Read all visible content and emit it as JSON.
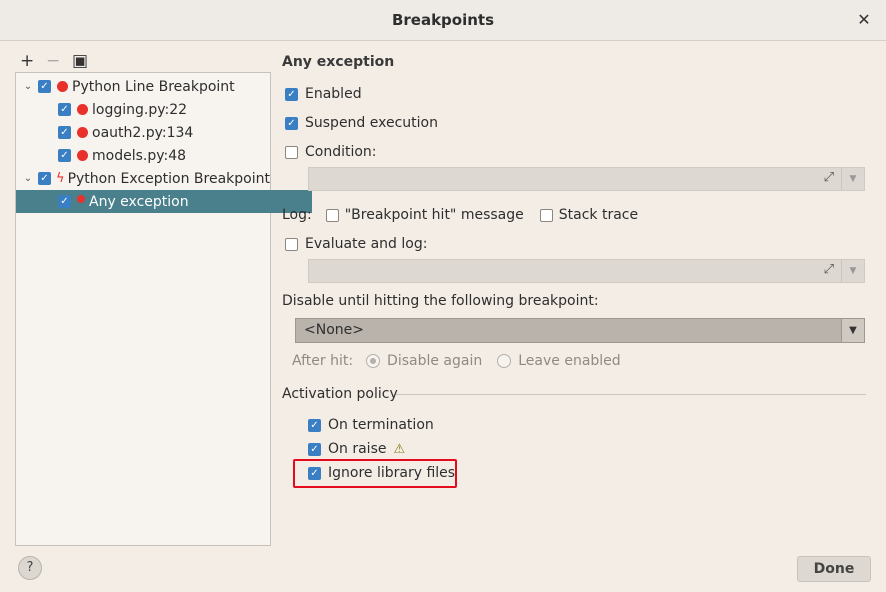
{
  "window": {
    "title": "Breakpoints",
    "close_glyph": "✕"
  },
  "toolbar": {
    "add": "+",
    "remove": "−",
    "view": "▣"
  },
  "tree": {
    "groups": [
      {
        "label": "Python Line Breakpoint",
        "checked": true,
        "items": [
          {
            "label": "logging.py:22",
            "checked": true
          },
          {
            "label": "oauth2.py:134",
            "checked": true
          },
          {
            "label": "models.py:48",
            "checked": true
          }
        ]
      },
      {
        "label": "Python Exception Breakpoint",
        "checked": true,
        "items": [
          {
            "label": "Any exception",
            "checked": true,
            "selected": true
          }
        ]
      }
    ]
  },
  "detail": {
    "title": "Any exception",
    "enabled": {
      "label": "Enabled",
      "checked": true
    },
    "suspend": {
      "label": "Suspend execution",
      "checked": true
    },
    "condition": {
      "label": "Condition:",
      "checked": false,
      "value": ""
    },
    "log": {
      "label": "Log:",
      "message": {
        "label": "\"Breakpoint hit\" message",
        "checked": false
      },
      "stack": {
        "label": "Stack trace",
        "checked": false
      }
    },
    "evaluate": {
      "label": "Evaluate and log:",
      "checked": false,
      "value": ""
    },
    "disable_until": {
      "label": "Disable until hitting the following breakpoint:",
      "value": "<None>"
    },
    "after_hit": {
      "label": "After hit:",
      "options": [
        {
          "label": "Disable again",
          "selected": true
        },
        {
          "label": "Leave enabled",
          "selected": false
        }
      ]
    },
    "activation": {
      "title": "Activation policy",
      "on_termination": {
        "label": "On termination",
        "checked": true
      },
      "on_raise": {
        "label": "On raise",
        "checked": true
      },
      "ignore_library": {
        "label": "Ignore library files",
        "checked": true
      }
    }
  },
  "footer": {
    "help_label": "?",
    "done_label": "Done"
  },
  "colors": {
    "accent": "#3a7fc4",
    "selection": "#4a7f8c",
    "breakpoint": "#e8312a",
    "highlight": "#e30c1c"
  },
  "icons": {
    "breakpoint": "red-dot-icon",
    "exception": "lightning-icon",
    "warning": "warning-icon",
    "expand": "expand-icon"
  }
}
